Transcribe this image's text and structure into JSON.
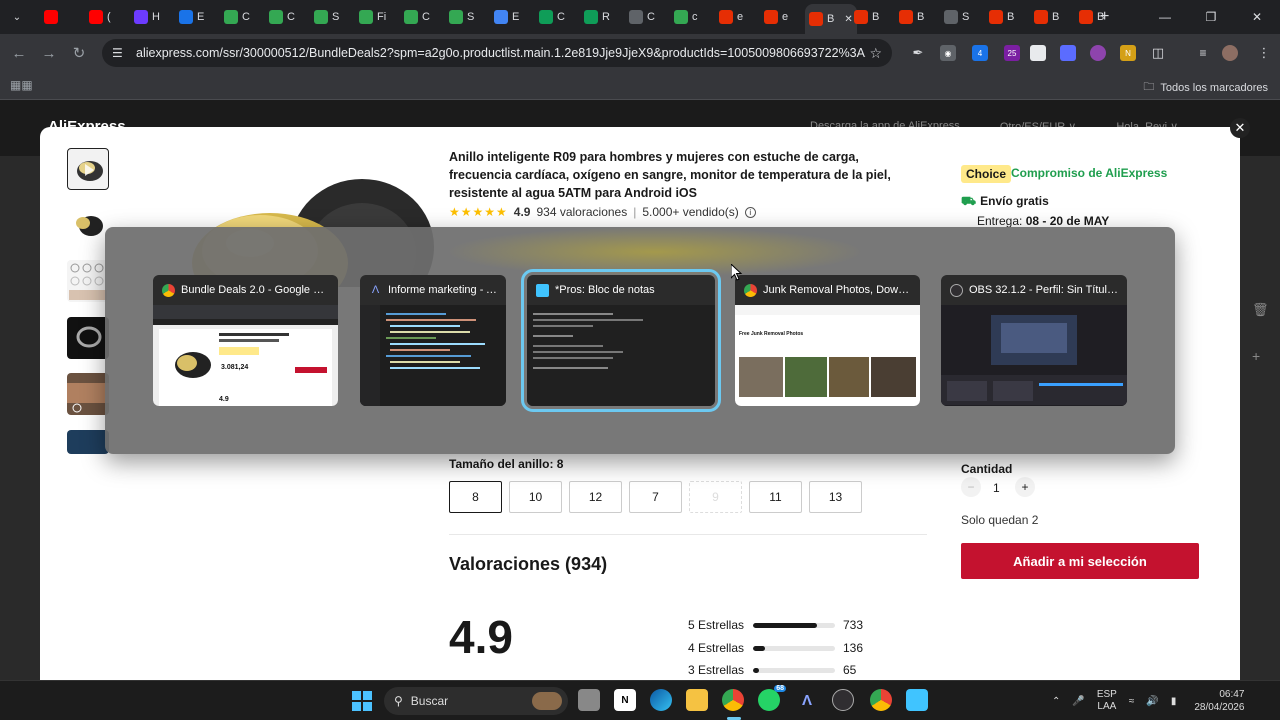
{
  "browser": {
    "tabs": [
      {
        "letter": "",
        "color": "#ff0000"
      },
      {
        "letter": "(",
        "color": "#ff0000"
      },
      {
        "letter": "H",
        "color": "#6c3bff"
      },
      {
        "letter": "E",
        "color": "#1a73e8"
      },
      {
        "letter": "C",
        "color": "#34a853"
      },
      {
        "letter": "C",
        "color": "#34a853"
      },
      {
        "letter": "S",
        "color": "#34a853"
      },
      {
        "letter": "Fi",
        "color": "#34a853"
      },
      {
        "letter": "C",
        "color": "#34a853"
      },
      {
        "letter": "S",
        "color": "#34a853"
      },
      {
        "letter": "E",
        "color": "#4285f4"
      },
      {
        "letter": "C",
        "color": "#0f9d58"
      },
      {
        "letter": "R",
        "color": "#0f9d58"
      },
      {
        "letter": "C",
        "color": "#5f6368"
      },
      {
        "letter": "c",
        "color": "#34a853"
      },
      {
        "letter": "e",
        "color": "#e62e04"
      },
      {
        "letter": "e",
        "color": "#e62e04"
      },
      {
        "letter": "B",
        "color": "#e62e04"
      },
      {
        "letter": "B",
        "color": "#e62e04"
      },
      {
        "letter": "B",
        "color": "#e62e04"
      },
      {
        "letter": "S",
        "color": "#5f6368"
      },
      {
        "letter": "B",
        "color": "#e62e04"
      },
      {
        "letter": "B",
        "color": "#e62e04"
      },
      {
        "letter": "B",
        "color": "#e62e04"
      }
    ],
    "url": "aliexpress.com/ssr/300000512/BundleDeals2?spm=a2g0o.productlist.main.1.2e819Jje9JjeX9&productIds=1005009806693722%3A12000050...",
    "bookmarks_label": "Todos los marcadores",
    "ext_badges": [
      "4",
      "25"
    ]
  },
  "site": {
    "logo": "AliExpress",
    "header_links": [
      "Descarga la app de AliExpress",
      "Otro/ES/EUR ∨",
      "Hola, Revi ∨"
    ]
  },
  "product": {
    "title": "Anillo inteligente R09 para hombres y mujeres con estuche de carga, frecuencia cardíaca, oxígeno en sangre, monitor de temperatura de la piel, resistente al agua 5ATM para Android iOS",
    "stars": "★★★★★",
    "rating": "4.9",
    "reviews_count": "934 valoraciones",
    "sold": "5.000+ vendido(s)",
    "choice_badge": "Choice",
    "choice_text": "Compromiso de AliExpress",
    "shipping": "Envío gratis",
    "delivery_label": "Entrega:",
    "delivery_dates": "08 - 20 de MAY",
    "size_label": "Tamaño del anillo: 8",
    "sizes": [
      "8",
      "10",
      "12",
      "7",
      "9",
      "11",
      "13"
    ],
    "reviews_title": "Valoraciones (934)",
    "big_score": "4.9",
    "breakdown": [
      {
        "label": "5 Estrellas",
        "count": "733",
        "fraction": 0.785
      },
      {
        "label": "4 Estrellas",
        "count": "136",
        "fraction": 0.146
      },
      {
        "label": "3 Estrellas",
        "count": "65",
        "fraction": 0.07
      }
    ],
    "qty_label": "Cantidad",
    "qty_minus": "−",
    "qty_value": "1",
    "qty_plus": "+",
    "stock": "Solo quedan 2",
    "add_button": "Añadir a mi selección"
  },
  "switcher": {
    "windows": [
      {
        "title": "Bundle Deals 2.0 - Google Chr...",
        "icon": "chrome-icon",
        "color": "#4285f4"
      },
      {
        "title": "Informe marketing - A...",
        "icon": "app-icon",
        "color": "#3b5bdb"
      },
      {
        "title": "*Pros: Bloc de notas",
        "icon": "notepad-icon",
        "color": "#40c4ff"
      },
      {
        "title": "Junk Removal Photos, Downlo...",
        "icon": "chrome-icon",
        "color": "#4285f4"
      },
      {
        "title": "OBS 32.1.2 - Perfil: Sin Título -...",
        "icon": "obs-icon",
        "color": "#302e31"
      }
    ],
    "preview_price": "3.081,24",
    "preview_score": "4.9",
    "preview_site_title": "Free Junk Removal Photos"
  },
  "taskbar": {
    "search": "Buscar",
    "whatsapp_badge": "68",
    "lang_top": "ESP",
    "lang_bottom": "LAA",
    "time": "06:47",
    "date": "28/04/2026"
  }
}
